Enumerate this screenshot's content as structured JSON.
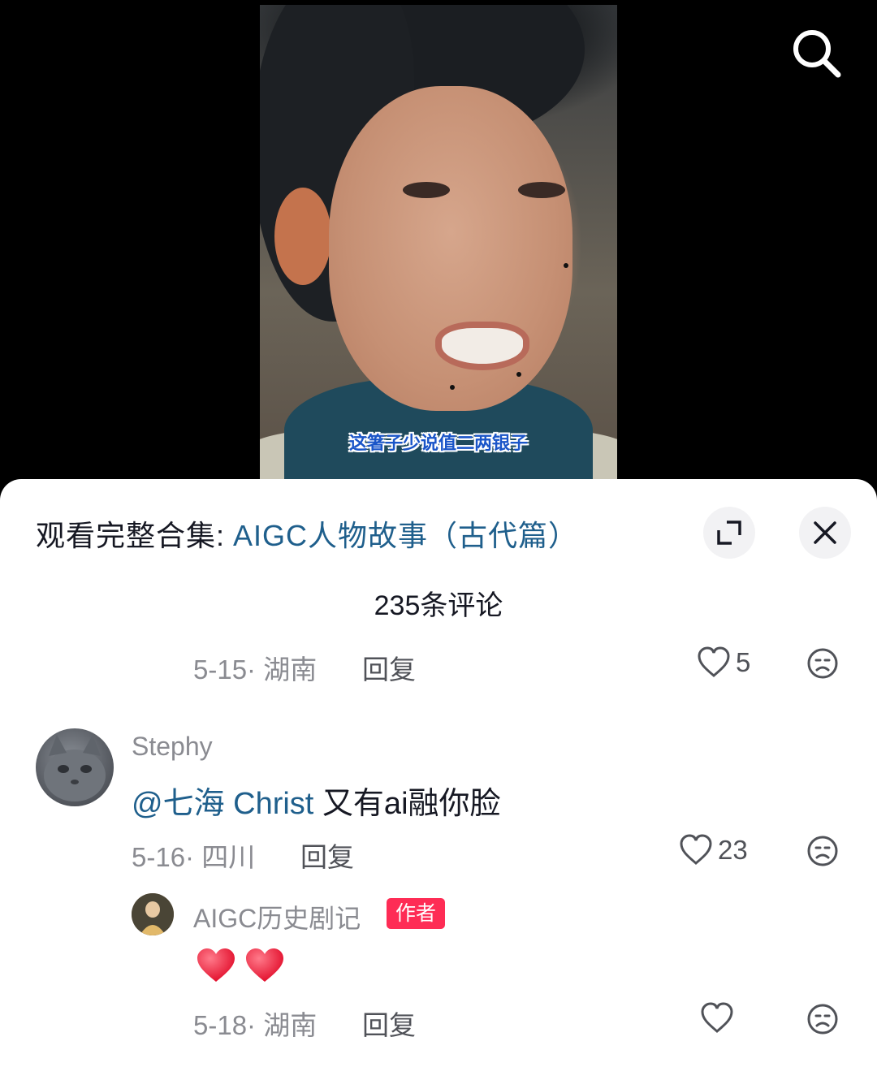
{
  "video": {
    "subtitle": "这箸子少说值二两银子"
  },
  "top_bar": {
    "search_icon": "search-icon"
  },
  "panel": {
    "collection_prefix": "观看完整合集:",
    "collection_title": "AIGC人物故事（古代篇）",
    "expand_icon": "expand-icon",
    "close_icon": "close-icon",
    "comment_count": "235条评论"
  },
  "comments": [
    {
      "date_location": "5-15· 湖南",
      "reply_label": "回复",
      "likes": "5"
    },
    {
      "user": "Stephy",
      "mention": "@七海 Christ",
      "text": " 又有ai融你脸",
      "date_location": "5-16· 四川",
      "reply_label": "回复",
      "likes": "23",
      "replies": [
        {
          "user": "AIGC历史剧记",
          "badge": "作者",
          "emoji": "❤️❤️",
          "date_location": "5-18· 湖南",
          "reply_label": "回复",
          "likes": ""
        }
      ]
    }
  ],
  "colors": {
    "link_blue": "#1f5f8c",
    "badge_red": "#fe2c55",
    "heart_red": "#f0213f",
    "meta_gray": "#8a8b91"
  }
}
